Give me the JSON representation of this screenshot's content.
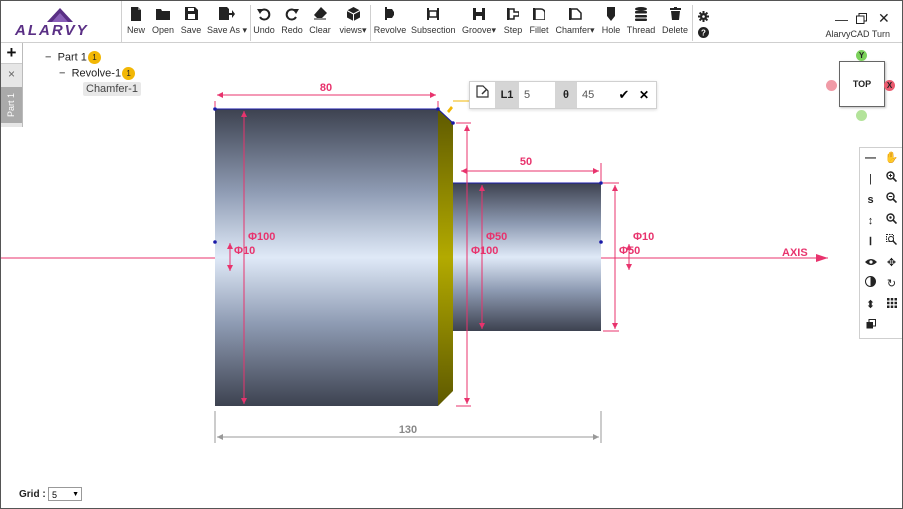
{
  "app": {
    "brand": "ALARVY",
    "title": "AlarvyCAD Turn"
  },
  "toolbar": {
    "file": [
      {
        "label": "New",
        "icon": "new-file-icon"
      },
      {
        "label": "Open",
        "icon": "folder-icon"
      },
      {
        "label": "Save",
        "icon": "save-icon"
      },
      {
        "label": "Save As",
        "icon": "save-as-icon",
        "dropdown": true
      }
    ],
    "edit": [
      {
        "label": "Undo",
        "icon": "undo-icon"
      },
      {
        "label": "Redo",
        "icon": "redo-icon"
      },
      {
        "label": "Clear",
        "icon": "eraser-icon"
      },
      {
        "label": "views",
        "icon": "cube-icon",
        "dropdown": true
      }
    ],
    "features": [
      {
        "label": "Revolve",
        "icon": "revolve-icon"
      },
      {
        "label": "Subsection",
        "icon": "subsection-icon"
      },
      {
        "label": "Groove",
        "icon": "groove-icon",
        "dropdown": true
      },
      {
        "label": "Step",
        "icon": "step-icon"
      },
      {
        "label": "Fillet",
        "icon": "fillet-icon"
      },
      {
        "label": "Chamfer",
        "icon": "chamfer-icon",
        "dropdown": true
      },
      {
        "label": "Hole",
        "icon": "hole-icon"
      },
      {
        "label": "Thread",
        "icon": "thread-icon"
      },
      {
        "label": "Delete",
        "icon": "trash-icon"
      }
    ]
  },
  "sidebar": {
    "add_symbol": "+",
    "close_symbol": "×",
    "tab_label": "Part 1"
  },
  "tree": {
    "part": {
      "label": "Part 1",
      "badge": "1"
    },
    "revolve": {
      "label": "Revolve-1",
      "badge": "1"
    },
    "chamfer": {
      "label": "Chamfer-1"
    }
  },
  "chamfer_params": {
    "l1_label": "L1",
    "l1_value": "5",
    "theta_label": "θ",
    "theta_value": "45"
  },
  "view_cube": {
    "face": "TOP",
    "y_label": "Y",
    "x_label": "X"
  },
  "drawing": {
    "dims": {
      "large_length": "80",
      "small_length": "50",
      "total_length": "130",
      "large_dia": "Φ100",
      "large_bore": "Φ10",
      "small_dia": "Φ50",
      "large_dia_ref": "Φ100",
      "small_bore": "Φ10",
      "small_bore_ref": "Φ50"
    },
    "axis_label": "AXIS",
    "colors": {
      "dimension": "#e8336d",
      "total_dim": "#999999",
      "chamfer_face": "#a39a00",
      "edge": "#1a1aa8"
    }
  },
  "right_toolbar": {
    "col1": [
      "minus",
      "|",
      "s",
      "↕",
      "I",
      "eye",
      "contrast",
      "updown",
      "layers"
    ],
    "col2": [
      "hand",
      "zoom-in",
      "zoom-out",
      "zoom-fit",
      "zoom-window",
      "pan",
      "rotate",
      "grid"
    ]
  },
  "grid": {
    "label": "Grid :",
    "value": "5"
  }
}
